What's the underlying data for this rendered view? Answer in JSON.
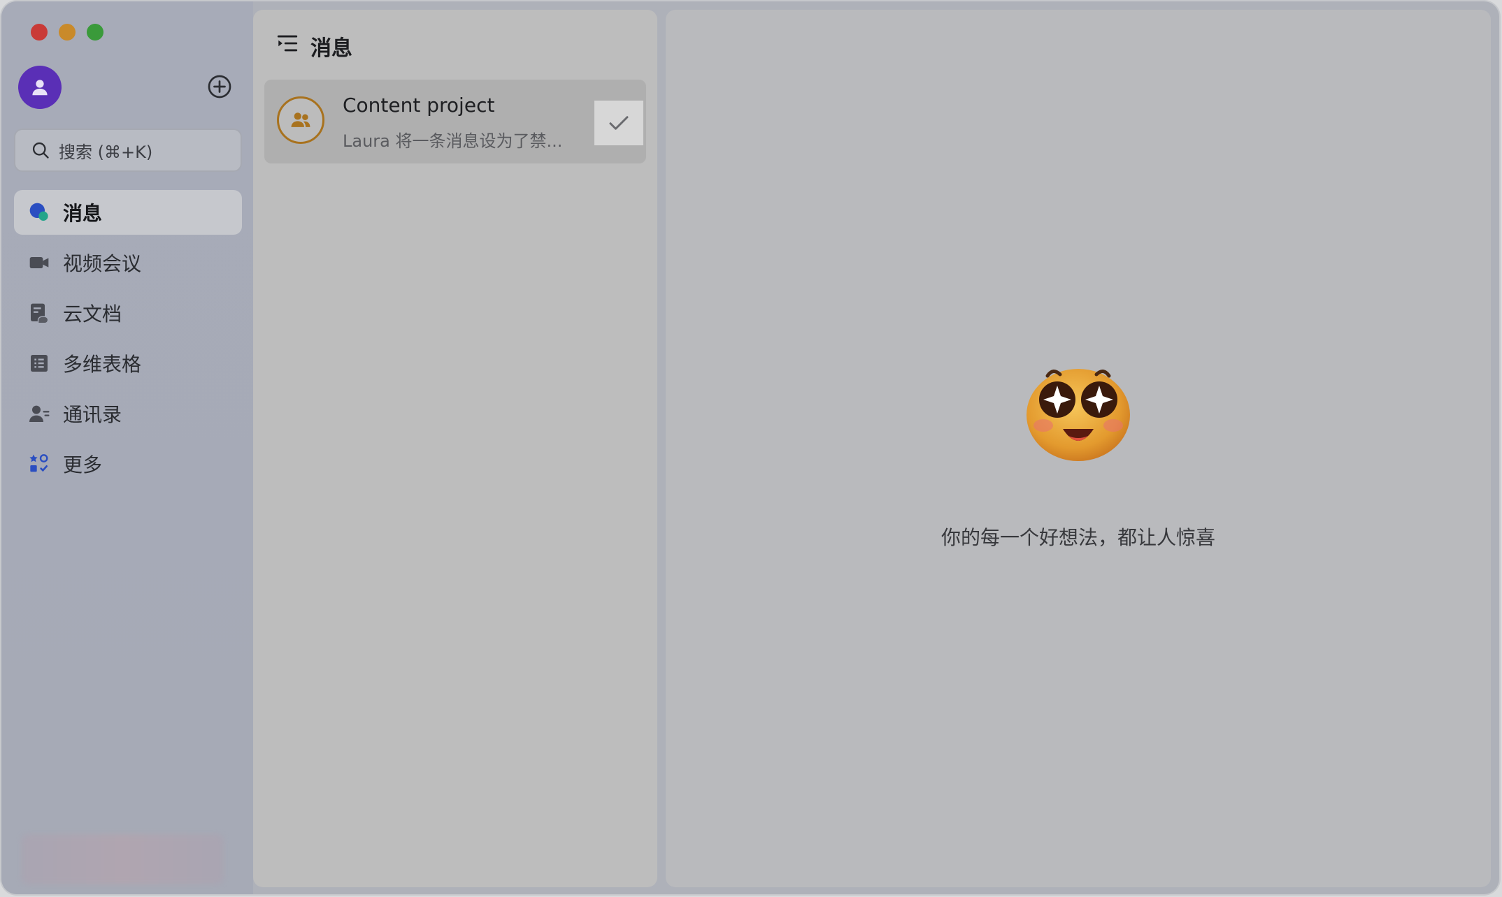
{
  "window": {
    "title": "消息"
  },
  "sidebar": {
    "search": {
      "placeholder": "搜索 (⌘+K)"
    },
    "nav": [
      {
        "label": "消息",
        "icon": "chat-bubble-icon",
        "active": true
      },
      {
        "label": "视频会议",
        "icon": "video-camera-icon",
        "active": false
      },
      {
        "label": "云文档",
        "icon": "cloud-doc-icon",
        "active": false
      },
      {
        "label": "多维表格",
        "icon": "table-icon",
        "active": false
      },
      {
        "label": "通讯录",
        "icon": "contacts-icon",
        "active": false
      },
      {
        "label": "更多",
        "icon": "apps-grid-icon",
        "active": false
      }
    ]
  },
  "list": {
    "title": "消息",
    "items": [
      {
        "name": "Content project",
        "preview": "Laura 将一条消息设为了禁...",
        "icon": "group-icon"
      }
    ]
  },
  "content": {
    "tagline": "你的每一个好想法，都让人惊喜"
  },
  "colors": {
    "accent_purple": "#5a2fb6",
    "group_border": "#a8721e",
    "close": "#c93a37",
    "minimize": "#c98a2a",
    "maximize": "#3a9a3a"
  }
}
